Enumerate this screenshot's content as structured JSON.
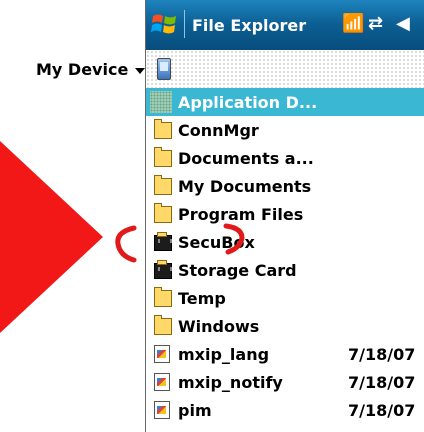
{
  "title": "File Explorer",
  "status_icons": [
    "antenna-icon",
    "sync-icon",
    "volume-icon"
  ],
  "location": {
    "label": "My Device",
    "icon": "device-icon"
  },
  "items": [
    {
      "name": "Application D...",
      "type": "selected-folder",
      "date": ""
    },
    {
      "name": "ConnMgr",
      "type": "folder",
      "date": ""
    },
    {
      "name": "Documents a...",
      "type": "folder",
      "date": ""
    },
    {
      "name": "My Documents",
      "type": "folder",
      "date": ""
    },
    {
      "name": "Program Files",
      "type": "folder",
      "date": ""
    },
    {
      "name": "SecuBox",
      "type": "storage",
      "date": ""
    },
    {
      "name": "Storage Card",
      "type": "storage",
      "date": ""
    },
    {
      "name": "Temp",
      "type": "folder",
      "date": ""
    },
    {
      "name": "Windows",
      "type": "folder",
      "date": ""
    },
    {
      "name": "mxip_lang",
      "type": "file",
      "date": "7/18/07"
    },
    {
      "name": "mxip_notify",
      "type": "file",
      "date": "7/18/07"
    },
    {
      "name": "pim",
      "type": "file",
      "date": "7/18/07"
    }
  ],
  "colors": {
    "titlebar": "#0c5f94",
    "selection": "#3ab8d3",
    "arrow": "#f21818"
  }
}
